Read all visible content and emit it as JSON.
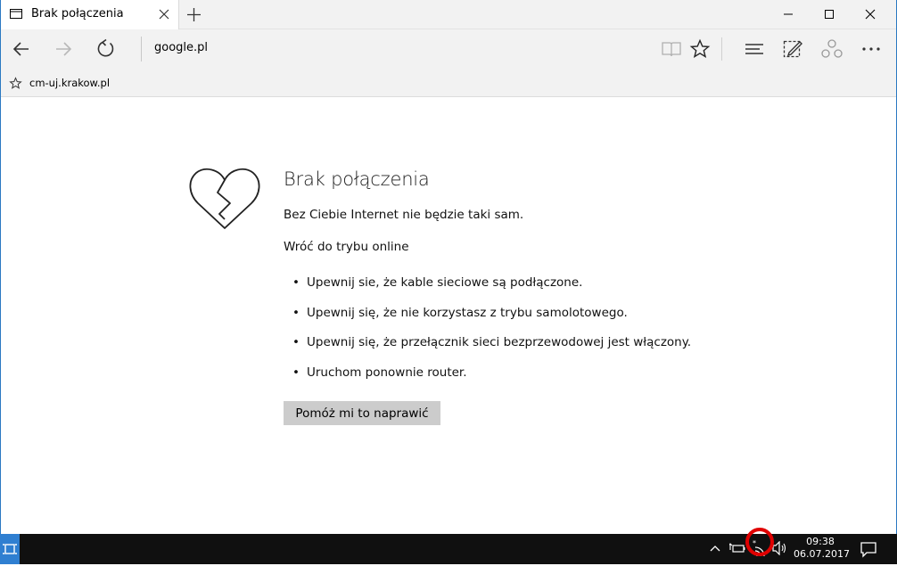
{
  "browser": {
    "tab_title": "Brak połączenia",
    "address": "google.pl",
    "favorite_item": "cm-uj.krakow.pl"
  },
  "error_page": {
    "title": "Brak połączenia",
    "subtitle": "Bez Ciebie Internet nie będzie taki sam.",
    "section_heading": "Wróć do trybu online",
    "tips": [
      "Upewnij sie, że kable sieciowe są podłączone.",
      "Upewnij się, że nie korzystasz z trybu samolotowego.",
      "Upewnij się, że przełącznik sieci bezprzewodowej jest włączony.",
      "Uruchom ponownie router."
    ],
    "fix_button": "Pomóż mi to naprawić"
  },
  "taskbar": {
    "time": "09:38",
    "date": "06.07.2017"
  },
  "colors": {
    "accent": "#2b79c2",
    "chrome": "#f2f2f2",
    "button": "#cccccc",
    "highlight_ring": "#e00000"
  },
  "icons": [
    "tab-page-icon",
    "close-icon",
    "plus-icon",
    "minimize-icon",
    "maximize-icon",
    "back-icon",
    "forward-icon",
    "refresh-icon",
    "reading-view-icon",
    "favorite-star-icon",
    "hub-icon",
    "web-note-icon",
    "share-icon",
    "more-icon",
    "broken-heart-icon",
    "task-view-icon",
    "chevron-up-icon",
    "battery-icon",
    "wifi-icon",
    "speaker-icon",
    "notification-icon"
  ]
}
